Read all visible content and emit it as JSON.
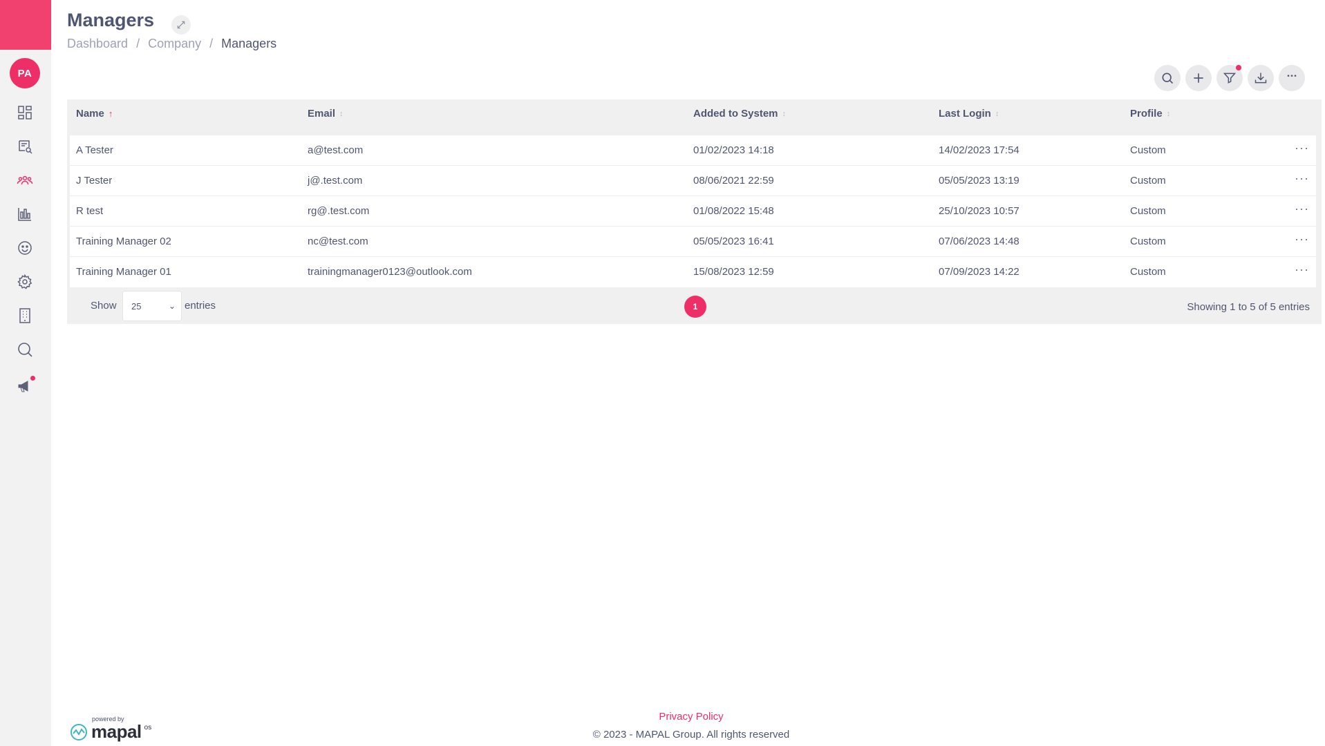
{
  "sidebar": {
    "avatar_initials": "PA",
    "items": [
      {
        "icon": "dashboard-icon"
      },
      {
        "icon": "search-document-icon"
      },
      {
        "icon": "people-icon",
        "active": true
      },
      {
        "icon": "bar-chart-icon"
      },
      {
        "icon": "smiley-icon"
      },
      {
        "icon": "gear-icon"
      },
      {
        "icon": "building-icon"
      },
      {
        "icon": "search-icon"
      },
      {
        "icon": "megaphone-icon",
        "badge": true
      }
    ]
  },
  "header": {
    "title": "Managers",
    "breadcrumb": [
      "Dashboard",
      "Company",
      "Managers"
    ],
    "breadcrumb_sep": "/"
  },
  "toolbar": {
    "buttons": [
      "search-icon",
      "plus-icon",
      "filter-icon",
      "download-icon",
      "more-icon"
    ]
  },
  "table": {
    "columns": [
      "Name",
      "Email",
      "Added to System",
      "Last Login",
      "Profile"
    ],
    "sort_column": "Name",
    "rows": [
      {
        "name": "A Tester",
        "email": "a@test.com",
        "added": "01/02/2023 14:18",
        "last_login": "14/02/2023 17:54",
        "profile": "Custom"
      },
      {
        "name": "J Tester",
        "email": "j@.test.com",
        "added": "08/06/2021 22:59",
        "last_login": "05/05/2023 13:19",
        "profile": "Custom"
      },
      {
        "name": "R test",
        "email": "rg@.test.com",
        "added": "01/08/2022 15:48",
        "last_login": "25/10/2023 10:57",
        "profile": "Custom"
      },
      {
        "name": "Training Manager 02",
        "email": "nc@test.com",
        "added": "05/05/2023 16:41",
        "last_login": "07/06/2023 14:48",
        "profile": "Custom"
      },
      {
        "name": "Training Manager 01",
        "email": "trainingmanager0123@outlook.com",
        "added": "15/08/2023 12:59",
        "last_login": "07/09/2023 14:22",
        "profile": "Custom"
      }
    ],
    "footer": {
      "show_label": "Show",
      "entries_value": "25",
      "entries_label": "entries",
      "current_page": "1",
      "showing_text": "Showing 1 to 5 of 5 entries"
    }
  },
  "footer": {
    "powered_by": "powered by",
    "logo_text": "mapal",
    "logo_suffix": "os",
    "privacy": "Privacy Policy",
    "copyright": "© 2023 - MAPAL Group. All rights reserved"
  },
  "colors": {
    "accent": "#ee2e67",
    "brand_bar": "#f0416f",
    "text": "#4f5671"
  }
}
